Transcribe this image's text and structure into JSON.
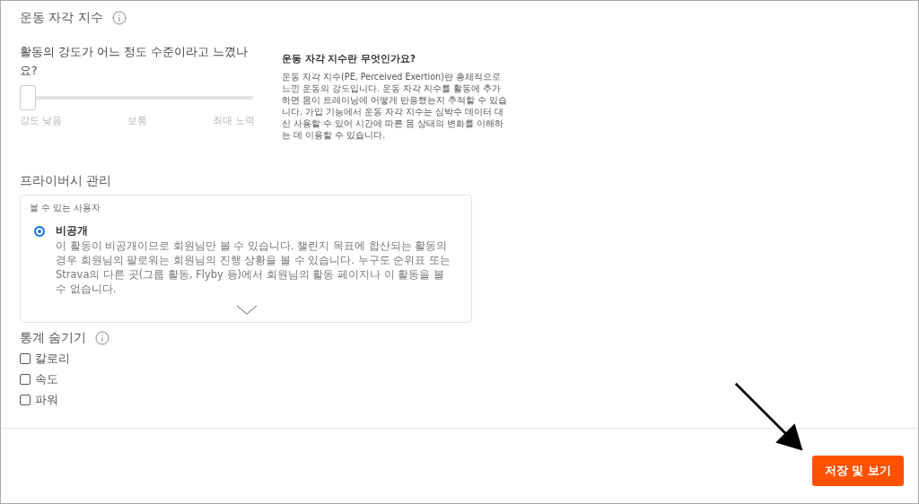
{
  "exertion": {
    "title": "운동 자각 지수",
    "question": "활동의 강도가 어느 정도 수준이라고 느꼈나요?",
    "slider": {
      "level": 0
    },
    "scale_labels": [
      "강도 낮음",
      "보통",
      "최대 노력"
    ],
    "help_title": "운동 자각 지수란 무엇인가요?",
    "help_text": "운동 자각 지수(PE, Perceived Exertion)란 총체적으로 느낀 운동의 강도입니다. 운동 자각 지수를 활동에 추가하면 몸이 트레이닝에 어떻게 반응했는지 추적할 수 있습니다. 가입 기능에서 운동 자각 지수는 심박수 데이터 대신 사용할 수 있어 시간에 따른 몸 상태의 변화를 이해하는 데 이용할 수 있습니다."
  },
  "privacy": {
    "title": "프라이버시 관리",
    "card_label": "볼 수 있는 사용자",
    "options": [
      {
        "label": "비공개",
        "description": "이 활동이 비공개이므로 회원님만 볼 수 있습니다. 챌린지 목표에 합산되는 활동의 경우 회원님의 팔로워는 회원님의 진행 상황을 볼 수 있습니다. 누구도 순위표 또는 Strava의 다른 곳(그룹 활동, Flyby 등)에서 회원님의 활동 페이지나 이 활동을 볼 수 없습니다.",
        "selected": true
      }
    ]
  },
  "hide_stats": {
    "title": "통계 숨기기",
    "items": [
      {
        "label": "칼로리",
        "checked": false
      },
      {
        "label": "속도",
        "checked": false
      },
      {
        "label": "파워",
        "checked": false
      }
    ]
  },
  "save_button": "저장 및 보기"
}
